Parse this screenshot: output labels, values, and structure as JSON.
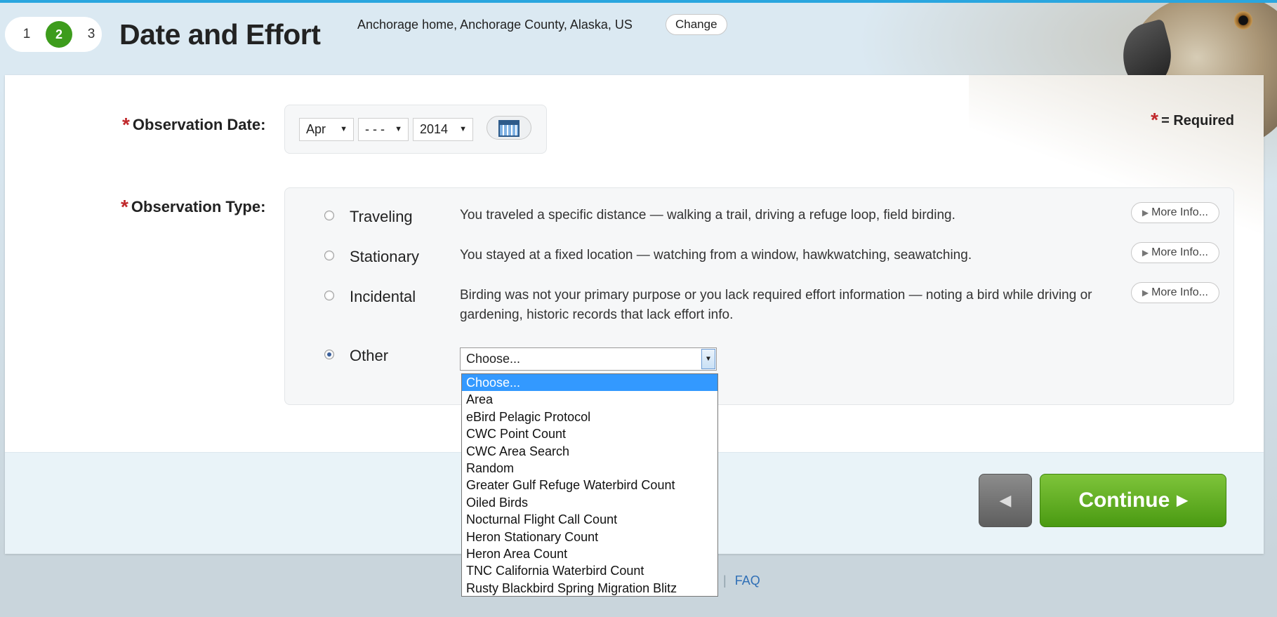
{
  "header": {
    "steps": [
      "1",
      "2",
      "3"
    ],
    "active_step": "2",
    "title": "Date and Effort",
    "location": "Anchorage home, Anchorage County, Alaska, US",
    "change_label": "Change"
  },
  "required_note": "= Required",
  "date": {
    "label": "Observation Date:",
    "month": "Apr",
    "day": "- - -",
    "year": "2014"
  },
  "observation_type": {
    "label": "Observation Type:",
    "options": [
      {
        "name": "Traveling",
        "description": "You traveled a specific distance — walking a trail, driving a refuge loop, field birding.",
        "more_info": "More Info..."
      },
      {
        "name": "Stationary",
        "description": "You stayed at a fixed location — watching from a window, hawkwatching, seawatching.",
        "more_info": "More Info..."
      },
      {
        "name": "Incidental",
        "description": "Birding was not your primary purpose or you lack required effort information — noting a bird while driving or gardening, historic records that lack effort info.",
        "more_info": "More Info..."
      },
      {
        "name": "Other",
        "selected": true
      }
    ],
    "other_select_value": "Choose...",
    "other_options": [
      "Choose...",
      "Area",
      "eBird Pelagic Protocol",
      "CWC Point Count",
      "CWC Area Search",
      "Random",
      "Greater Gulf Refuge Waterbird Count",
      "Oiled Birds",
      "Nocturnal Flight Call Count",
      "Heron Stationary Count",
      "Heron Area Count",
      "TNC California Waterbird Count",
      "Rusty Blackbird Spring Migration Blitz"
    ]
  },
  "nav": {
    "back_symbol": "◀",
    "continue_label": "Continue"
  },
  "footer": {
    "faq_label": "FAQ"
  },
  "colors": {
    "accent_blue": "#2aa6df",
    "step_active": "#3d9c1c",
    "continue_green": "#5aad1f",
    "required_red": "#c0282b",
    "dropdown_highlight": "#3399ff"
  },
  "icons": [
    "calendar-icon",
    "triangle-right-icon",
    "eagle-decoration"
  ]
}
